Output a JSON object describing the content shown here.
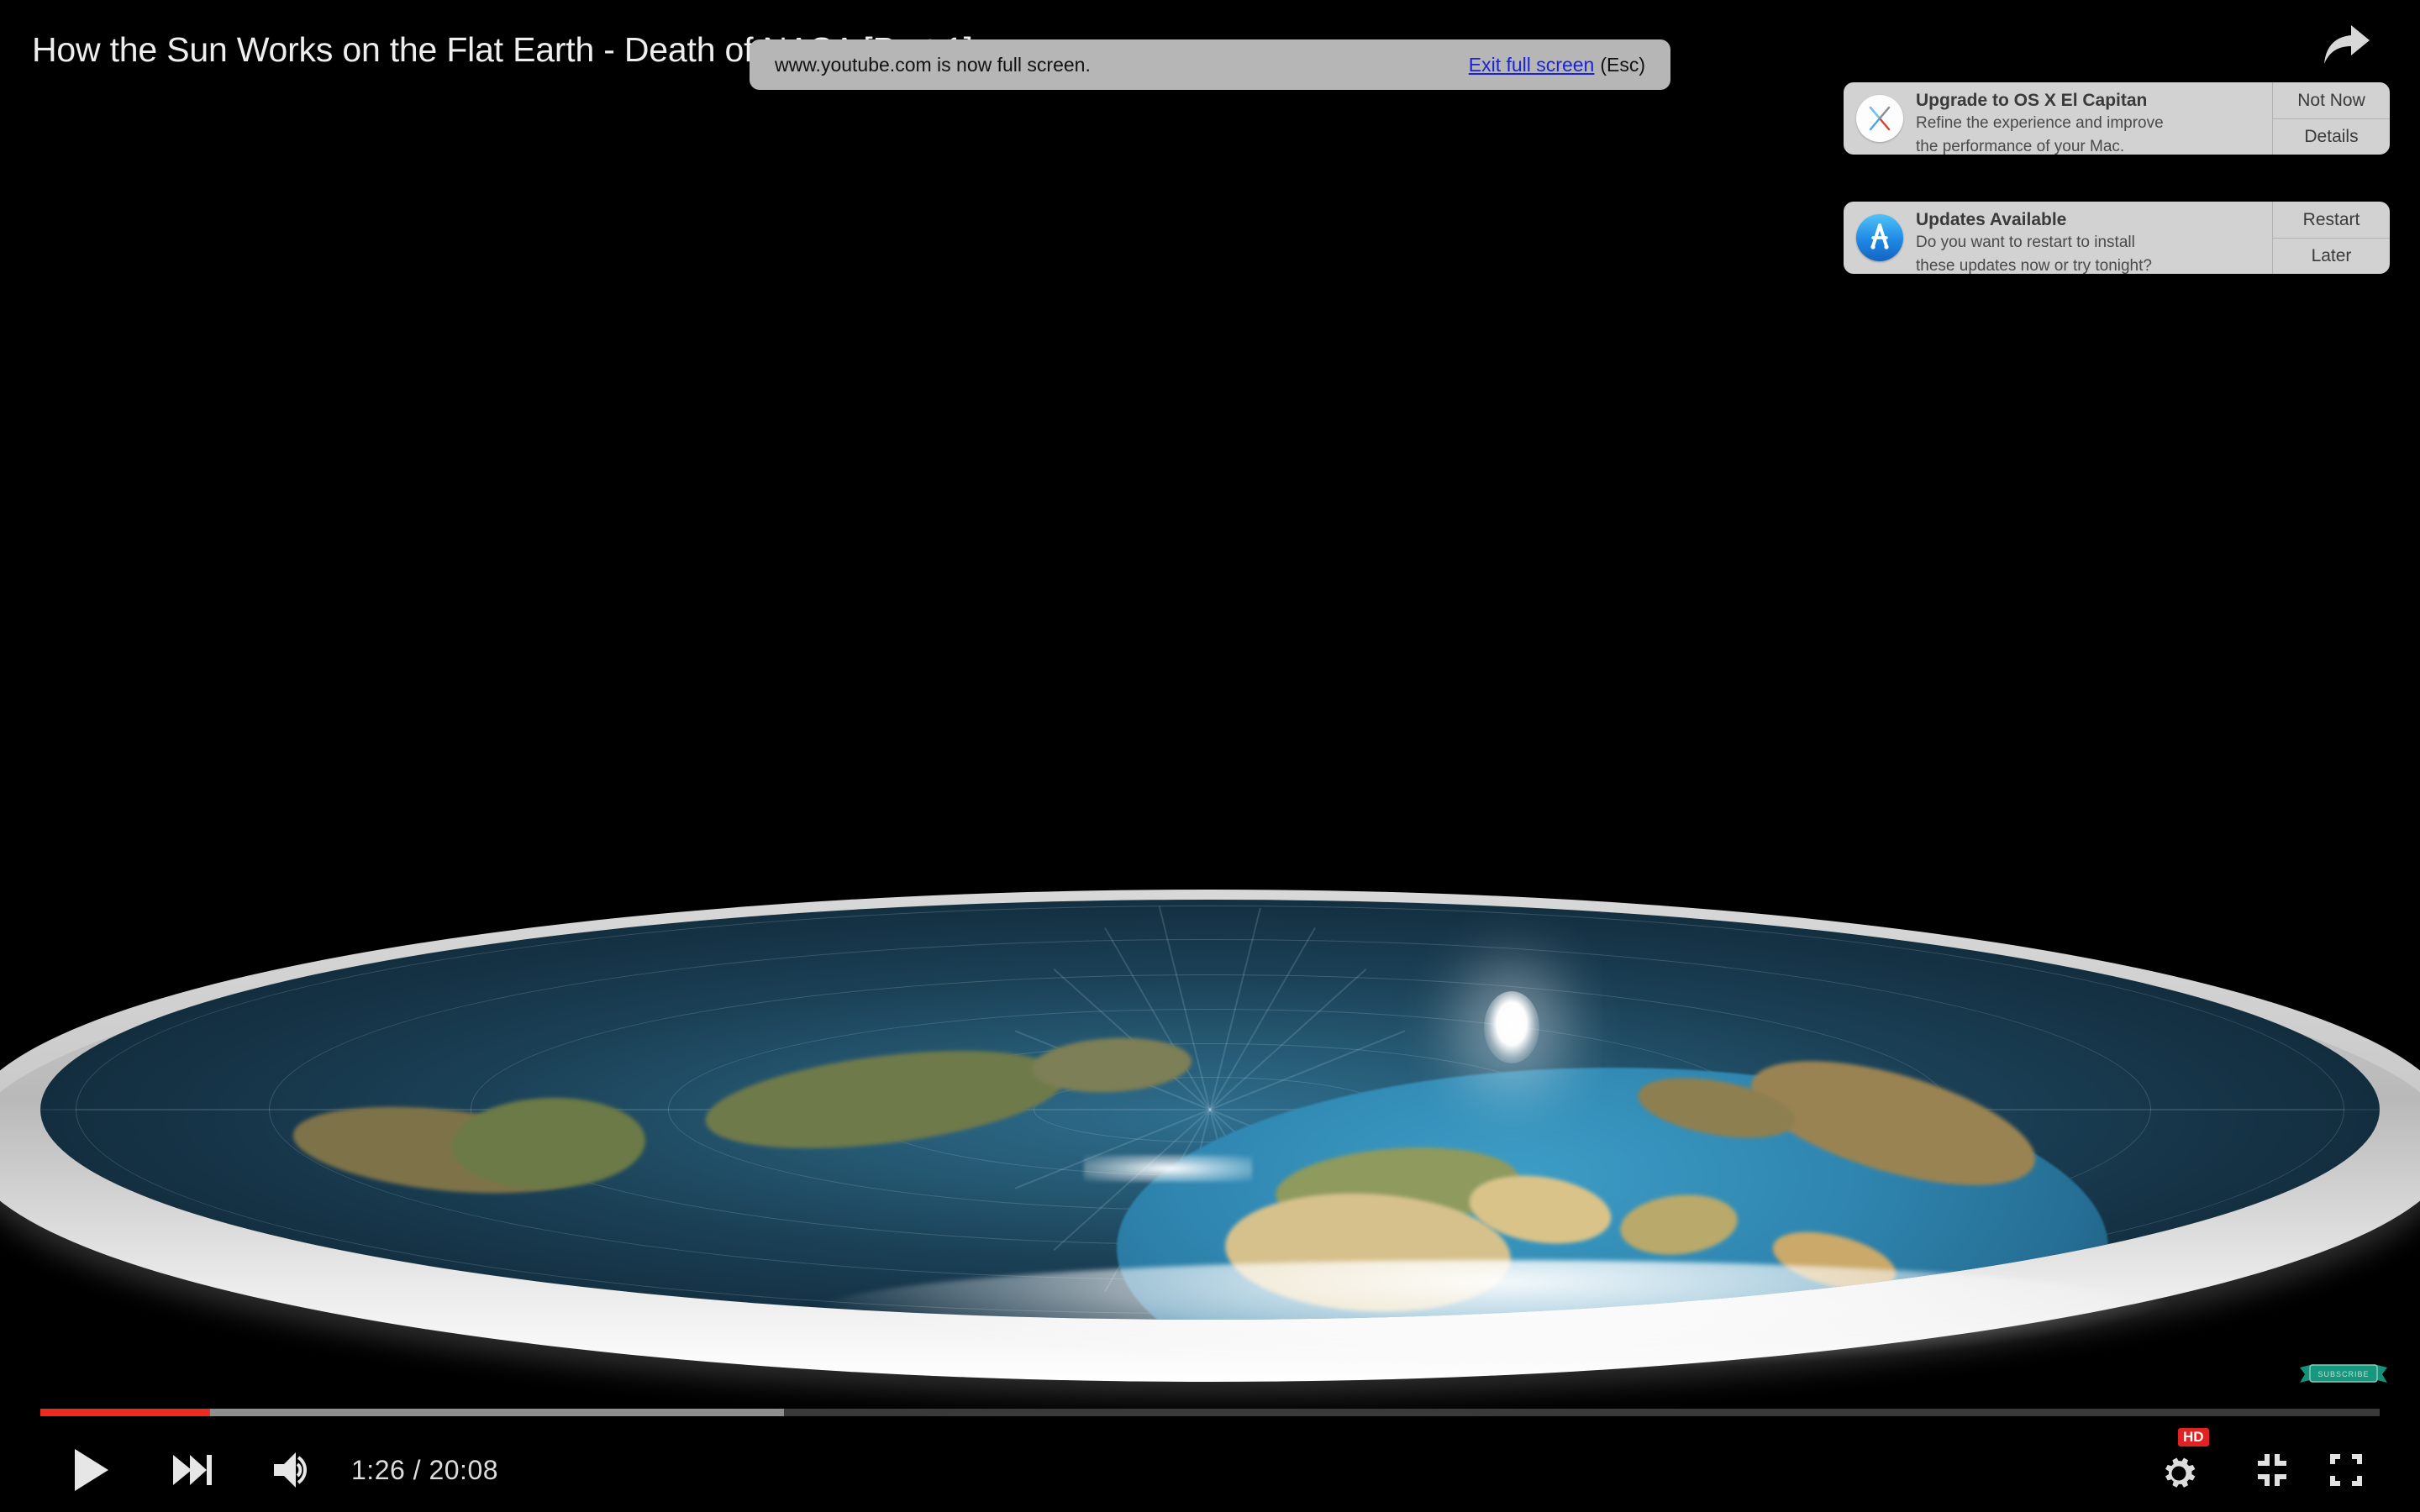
{
  "player": {
    "video_title": "How the Sun Works on the Flat Earth - Death of NASA [Part 1]",
    "current_time": "1:26",
    "duration": "20:08",
    "time_display": "1:26 / 20:08",
    "progress_percent": 7.25,
    "loaded_percent": 31.8,
    "quality_badge": "HD",
    "watermark_label": "SUBSCRIBE",
    "colors": {
      "progress_played": "#ee2b20",
      "progress_loaded": "#8f8f8f",
      "progress_track": "#3a3a3a",
      "hd_badge": "#e02222",
      "watermark": "#17a589"
    },
    "controls": {
      "play": "play-icon",
      "next": "next-track-icon",
      "volume": "volume-icon",
      "settings": "gear-icon",
      "theater": "theater-mode-icon",
      "fullscreen": "exit-fullscreen-icon",
      "share": "share-icon"
    }
  },
  "fullscreen_toast": {
    "message": "www.youtube.com is now full screen.",
    "exit_link": "Exit full screen",
    "esc_hint": "(Esc)",
    "link_color": "#1a24d6",
    "background": "#b6b6b6"
  },
  "notifications": [
    {
      "id": "capitan",
      "icon": "os-x-el-capitan-icon",
      "title": "Upgrade to OS X El Capitan",
      "body_line1": "Refine the experience and improve",
      "body_line2": "the performance of your Mac.",
      "buttons": [
        "Not Now",
        "Details"
      ]
    },
    {
      "id": "updates",
      "icon": "app-store-icon",
      "title": "Updates Available",
      "body_line1": "Do you want to restart to install",
      "body_line2": "these updates now or try tonight?",
      "buttons": [
        "Restart",
        "Later"
      ]
    }
  ]
}
